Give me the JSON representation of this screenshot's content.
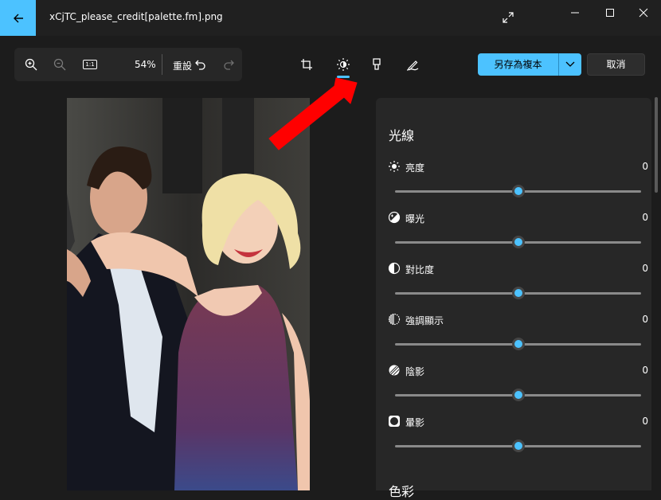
{
  "window": {
    "title": "xCjTC_please_credit[palette.fm].png",
    "back_icon": "back-arrow-icon",
    "colors": {
      "accent": "#4cc2ff",
      "background": "#1c1c1c",
      "panel": "#272727",
      "annotation_arrow": "#ff0000"
    }
  },
  "toolbar": {
    "zoom_in_icon": "zoom-in-icon",
    "zoom_out_icon": "zoom-out-icon",
    "actual_size_label": "1:1",
    "zoom_level": "54%",
    "reset_label": "重設",
    "undo_icon": "undo-icon",
    "redo_icon": "redo-icon"
  },
  "edit_tools": {
    "items": [
      {
        "name": "crop",
        "icon": "crop-icon",
        "active": false
      },
      {
        "name": "adjustment",
        "icon": "brightness-icon",
        "active": true
      },
      {
        "name": "filter",
        "icon": "filter-icon",
        "active": false
      },
      {
        "name": "markup",
        "icon": "markup-pen-icon",
        "active": false
      }
    ]
  },
  "actions": {
    "save_copy_label": "另存為複本",
    "cancel_label": "取消"
  },
  "panel": {
    "section_title": "光線",
    "adjustments": [
      {
        "label": "亮度",
        "value": "0",
        "icon": "brightness-icon",
        "level": 0.5
      },
      {
        "label": "曝光",
        "value": "0",
        "icon": "exposure-icon",
        "level": 0.5
      },
      {
        "label": "對比度",
        "value": "0",
        "icon": "contrast-icon",
        "level": 0.5
      },
      {
        "label": "強調顯示",
        "value": "0",
        "icon": "highlights-icon",
        "level": 0.5
      },
      {
        "label": "陰影",
        "value": "0",
        "icon": "shadows-icon",
        "level": 0.5
      },
      {
        "label": "暈影",
        "value": "0",
        "icon": "vignette-icon",
        "level": 0.5
      }
    ],
    "next_section_title": "色彩"
  }
}
